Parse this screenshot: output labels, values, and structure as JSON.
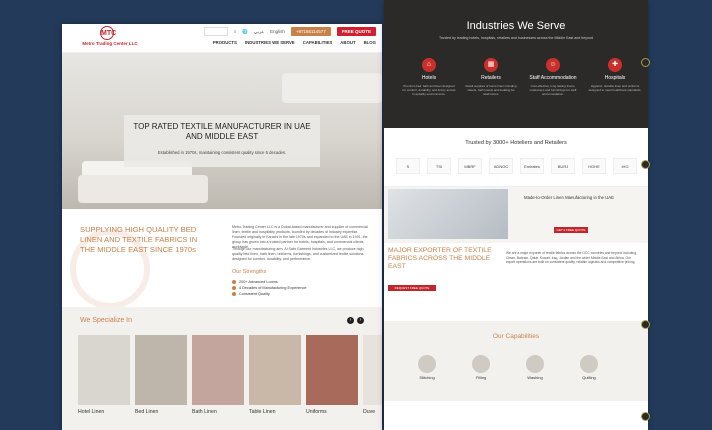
{
  "header": {
    "logo_mark": "MTC",
    "logo_text": "Metro Trading Center LLC",
    "links": {
      "language_ar": "عربي",
      "language_en": "English",
      "phone": "+97165114577",
      "quote": "FREE QUOTE"
    },
    "nav": [
      "PRODUCTS",
      "INDUSTRIES WE SERVE",
      "CAPABILITIES",
      "ABOUT",
      "BLOG"
    ]
  },
  "hero": {
    "title": "TOP RATED TEXTILE MANUFACTURER IN UAE AND MIDDLE EAST",
    "subtitle": "Established in 1970s, maintaining consistent quality since 5 decades."
  },
  "about": {
    "heading": "SUPPLYING HIGH QUALITY BED LINEN AND TEXTILE FABRICS IN THE MIDDLE EAST SINCE 1970s",
    "para1": "Metro Trading Center LLC is a Dubai-based manufacturer and supplier of commercial linen, textile and hospitality products, founded by decades of industry expertise. Founded originally in Karachi in the late 1970s and expanded to the UAE in 1991, the group has grown into a trusted partner for hotels, hospitals, and commercial clients worldwide.",
    "para2": "Through our manufacturing arm, Al Safir Garment Industries LLC, we produce high quality bed linen, bath linen, uniforms, furnishings, and customized textile solutions designed for comfort, durability, and performance.",
    "strengths_title": "Our Strengths",
    "strengths": [
      "200+ Advanced Looms",
      "4 Decades of Manufacturing Experience",
      "Consistent Quality"
    ]
  },
  "specialize": {
    "title": "We Specialize In",
    "items": [
      {
        "label": "Hotel Linen",
        "color": "#d9d6d0"
      },
      {
        "label": "Bed Linen",
        "color": "#bfb6ab"
      },
      {
        "label": "Bath Linen",
        "color": "#c4a59e"
      },
      {
        "label": "Table Linen",
        "color": "#c9b8a8"
      },
      {
        "label": "Uniforms",
        "color": "#a86a5a"
      },
      {
        "label": "Duve",
        "color": "#e6e2dc"
      }
    ]
  },
  "industries": {
    "title": "Industries We Serve",
    "subtitle": "Trusted by leading hotels, hospitals, retailers and businesses across the Middle East and beyond",
    "items": [
      {
        "title": "Hotels",
        "icon": "hotel-icon",
        "desc": "Premium bed, bath and linen designed for comfort, durability, and luxury across hospitality environments."
      },
      {
        "title": "Retailers",
        "icon": "store-icon",
        "desc": "Retail supplies of home linen including sheets, bath towels and bedding for retail stores."
      },
      {
        "title": "Staff Accommodation",
        "icon": "people-icon",
        "desc": "Cost-effective, long-lasting linens, mattresses and furnishings for staff accommodation."
      },
      {
        "title": "Hospitals",
        "icon": "medical-icon",
        "desc": "Hygienic, durable linen and uniforms designed to meet healthcare standards."
      }
    ]
  },
  "trusted": {
    "title": "Trusted by 3000+ Hoteliers and Retailers",
    "logos": [
      "S",
      "TSI",
      "MBRF",
      "ADNOC",
      "Emirates",
      "BURJ",
      "HOHE",
      "IHG"
    ]
  },
  "made_to_order": {
    "title": "Made-to-Order Linen Manufacturing in the UAE",
    "button": "GET A FREE QUOTE"
  },
  "exporter": {
    "title": "MAJOR EXPORTER OF TEXTILE FABRICS ACROSS THE MIDDLE EAST",
    "button": "REQUEST FREE QUOTE",
    "para": "We are a major exporter of textile fabrics across the GCC countries and beyond including Oman, Bahrain, Qatar, Kuwait, Iraq, Jordan and the wider Middle East and Africa. Our export operations are built on consistent quality, reliable logistics and competitive pricing."
  },
  "capabilities": {
    "title": "Our Capabilities",
    "items": [
      "Stitching",
      "Filling",
      "Washing",
      "Quilting"
    ]
  }
}
